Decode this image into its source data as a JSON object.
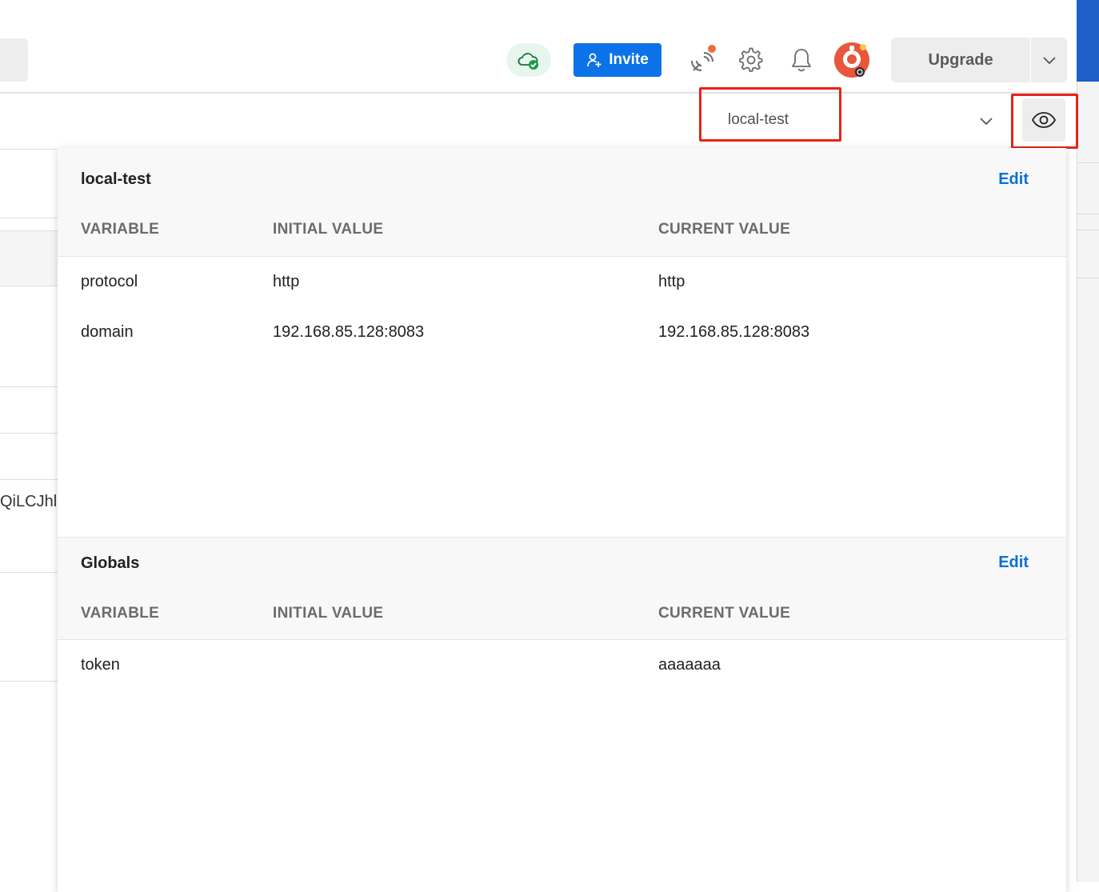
{
  "header": {
    "invite_label": "Invite",
    "upgrade_label": "Upgrade",
    "icons": [
      "cloud-sync-icon",
      "add-user-icon",
      "satellite-icon",
      "gear-icon",
      "bell-icon",
      "avatar",
      "chevron-down-icon"
    ]
  },
  "environment": {
    "selected": "local-test",
    "eye_icon": "eye-icon"
  },
  "background": {
    "truncated_text": "QiLCJhl"
  },
  "popover": {
    "environment_section": {
      "title": "local-test",
      "edit_label": "Edit",
      "columns": [
        "VARIABLE",
        "INITIAL VALUE",
        "CURRENT VALUE"
      ],
      "rows": [
        {
          "variable": "protocol",
          "initial": "http",
          "current": "http"
        },
        {
          "variable": "domain",
          "initial": "192.168.85.128:8083",
          "current": "192.168.85.128:8083"
        }
      ]
    },
    "globals_section": {
      "title": "Globals",
      "edit_label": "Edit",
      "columns": [
        "VARIABLE",
        "INITIAL VALUE",
        "CURRENT VALUE"
      ],
      "rows": [
        {
          "variable": "token",
          "initial": "",
          "current": "aaaaaaa"
        }
      ]
    }
  },
  "colors": {
    "accent": "#0b72e7",
    "highlight": "#e8231a",
    "link": "#0b6fd6",
    "sync_ok": "#1c9b4a",
    "avatar": "#e8573b"
  }
}
